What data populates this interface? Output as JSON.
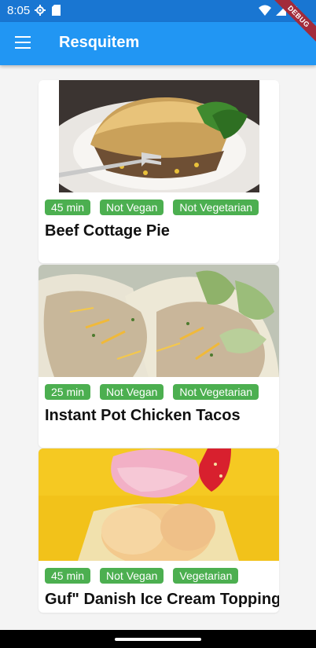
{
  "status_bar": {
    "time": "8:05"
  },
  "app_bar": {
    "title": "Resquitem"
  },
  "debug_banner": "DEBUG",
  "recipes": [
    {
      "title": "Beef Cottage Pie",
      "tags": [
        "45 min",
        "Not Vegan",
        "Not Vegetarian"
      ]
    },
    {
      "title": "Instant Pot Chicken Tacos",
      "tags": [
        "25 min",
        "Not Vegan",
        "Not Vegetarian"
      ]
    },
    {
      "title": "Guf\" Danish Ice Cream Topping",
      "tags": [
        "45 min",
        "Not Vegan",
        "Vegetarian"
      ]
    }
  ],
  "colors": {
    "primary": "#2196f3",
    "status_bar": "#1976d2",
    "tag": "#4caf50",
    "debug": "#a22b3b"
  }
}
